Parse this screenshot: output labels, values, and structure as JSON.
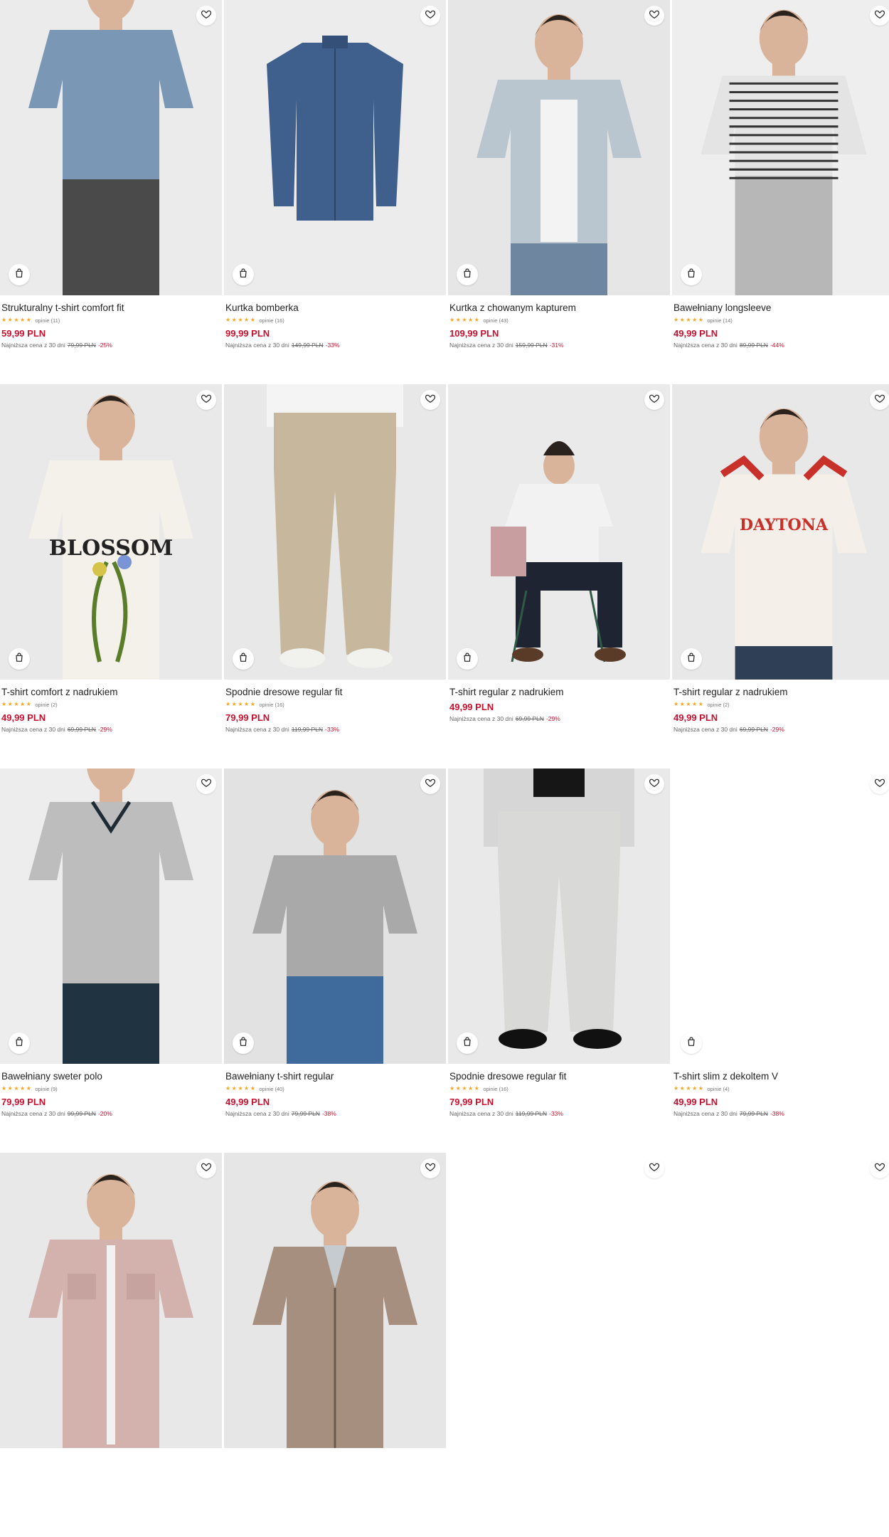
{
  "products": [
    {
      "name": "Strukturalny t-shirt comfort fit",
      "stars": "★★★★★",
      "reviews": "opinie (11)",
      "price": "59,99 PLN",
      "lowest_label": "Najniższa cena z 30 dni",
      "old_price": "79,99 PLN",
      "discount": "-25%",
      "image": "man-blue-tshirt",
      "bg": "#ebebeb"
    },
    {
      "name": "Kurtka bomberka",
      "stars": "★★★★★",
      "reviews": "opinie (16)",
      "price": "99,99 PLN",
      "lowest_label": "Najniższa cena z 30 dni",
      "old_price": "149,99 PLN",
      "discount": "-33%",
      "image": "navy-bomber-jacket",
      "bg": "#ececec"
    },
    {
      "name": "Kurtka z chowanym kapturem",
      "stars": "★★★★★",
      "reviews": "opinie (43)",
      "price": "109,99 PLN",
      "lowest_label": "Najniższa cena z 30 dni",
      "old_price": "159,99 PLN",
      "discount": "-31%",
      "image": "man-light-blue-jacket",
      "bg": "#e6e6e6"
    },
    {
      "name": "Bawełniany longsleeve",
      "stars": "★★★★★",
      "reviews": "opinie (14)",
      "price": "49,99 PLN",
      "lowest_label": "Najniższa cena z 30 dni",
      "old_price": "89,99 PLN",
      "discount": "-44%",
      "image": "man-striped-longsleeve",
      "bg": "#eeeeee"
    },
    {
      "name": "T-shirt comfort z nadrukiem",
      "stars": "★★★★★",
      "reviews": "opinie (2)",
      "price": "49,99 PLN",
      "lowest_label": "Najniższa cena z 30 dni",
      "old_price": "69,99 PLN",
      "discount": "-29%",
      "image": "man-white-blossom-tshirt",
      "bg": "#e9e9e9"
    },
    {
      "name": "Spodnie dresowe regular fit",
      "stars": "★★★★★",
      "reviews": "opinie (16)",
      "price": "79,99 PLN",
      "lowest_label": "Najniższa cena z 30 dni",
      "old_price": "119,99 PLN",
      "discount": "-33%",
      "image": "beige-joggers",
      "bg": "#e8e8e8"
    },
    {
      "name": "T-shirt regular z nadrukiem",
      "stars": "",
      "reviews": "",
      "price": "49,99 PLN",
      "lowest_label": "Najniższa cena z 30 dni",
      "old_price": "69,99 PLN",
      "discount": "-29%",
      "image": "man-seated-white-tshirt",
      "bg": "#eaeaea"
    },
    {
      "name": "T-shirt regular z nadrukiem",
      "stars": "★★★★★",
      "reviews": "opinie (2)",
      "price": "49,99 PLN",
      "lowest_label": "Najniższa cena z 30 dni",
      "old_price": "69,99 PLN",
      "discount": "-29%",
      "image": "man-daytona-tshirt",
      "bg": "#e8e8e8"
    },
    {
      "name": "Bawełniany sweter polo",
      "stars": "★★★★★",
      "reviews": "opinie (9)",
      "price": "79,99 PLN",
      "lowest_label": "Najniższa cena z 30 dni",
      "old_price": "99,99 PLN",
      "discount": "-20%",
      "image": "man-grey-polo",
      "bg": "#ededed"
    },
    {
      "name": "Bawełniany t-shirt regular",
      "stars": "★★★★★",
      "reviews": "opinie (40)",
      "price": "49,99 PLN",
      "lowest_label": "Najniższa cena z 30 dni",
      "old_price": "79,99 PLN",
      "discount": "-38%",
      "image": "man-grey-tshirt",
      "bg": "#e2e2e2"
    },
    {
      "name": "Spodnie dresowe regular fit",
      "stars": "★★★★★",
      "reviews": "opinie (16)",
      "price": "79,99 PLN",
      "lowest_label": "Najniższa cena z 30 dni",
      "old_price": "119,99 PLN",
      "discount": "-33%",
      "image": "grey-joggers",
      "bg": "#e9e9e9"
    },
    {
      "name": "T-shirt slim z dekoltem V",
      "stars": "★★★★★",
      "reviews": "opinie (4)",
      "price": "49,99 PLN",
      "lowest_label": "Najniższa cena z 30 dni",
      "old_price": "79,99 PLN",
      "discount": "-38%",
      "image": "blank",
      "bg": "#ffffff"
    },
    {
      "name": "",
      "stars": "",
      "reviews": "",
      "price": "",
      "lowest_label": "",
      "old_price": "",
      "discount": "",
      "image": "man-pink-overshirt",
      "bg": "#e8e8e8"
    },
    {
      "name": "",
      "stars": "",
      "reviews": "",
      "price": "",
      "lowest_label": "",
      "old_price": "",
      "discount": "",
      "image": "man-brown-zip-jacket",
      "bg": "#e6e6e6"
    },
    {
      "name": "",
      "stars": "",
      "reviews": "",
      "price": "",
      "lowest_label": "",
      "old_price": "",
      "discount": "",
      "image": "blank",
      "bg": "#ffffff"
    },
    {
      "name": "",
      "stars": "",
      "reviews": "",
      "price": "",
      "lowest_label": "",
      "old_price": "",
      "discount": "",
      "image": "blank",
      "bg": "#ffffff"
    }
  ],
  "icons": {
    "favorite": "heart-icon",
    "add_to_bag": "shopping-bag-icon"
  },
  "colors": {
    "price": "#c8102e",
    "stars": "#f5a623",
    "text": "#222222"
  }
}
